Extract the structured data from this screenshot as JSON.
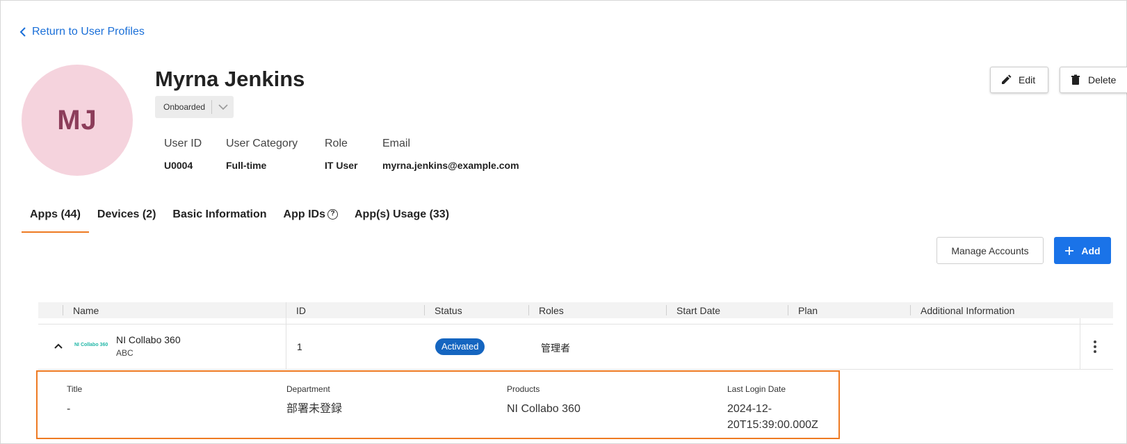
{
  "nav": {
    "back_label": "Return to User Profiles"
  },
  "user": {
    "initials": "MJ",
    "name": "Myrna Jenkins",
    "status": "Onboarded",
    "fields": [
      {
        "label": "User ID",
        "value": "U0004"
      },
      {
        "label": "User Category",
        "value": "Full-time"
      },
      {
        "label": "Role",
        "value": "IT User"
      },
      {
        "label": "Email",
        "value": "myrna.jenkins@example.com"
      }
    ]
  },
  "actions": {
    "edit_label": "Edit",
    "delete_label": "Delete"
  },
  "tabs": [
    {
      "label": "Apps (44)"
    },
    {
      "label": "Devices (2)"
    },
    {
      "label": "Basic Information"
    },
    {
      "label": "App IDs"
    },
    {
      "label": "App(s) Usage (33)"
    }
  ],
  "toolbar": {
    "manage_label": "Manage Accounts",
    "add_label": "Add"
  },
  "table": {
    "columns": [
      "Name",
      "ID",
      "Status",
      "Roles",
      "Start Date",
      "Plan",
      "Additional Information"
    ],
    "rows": [
      {
        "logo_text": "NI Collabo 360",
        "name": "NI Collabo 360",
        "sub": "ABC",
        "id": "1",
        "status": "Activated",
        "roles": "管理者",
        "start_date": "",
        "plan": "",
        "additional": ""
      }
    ]
  },
  "detail": {
    "items": [
      {
        "label": "Title",
        "value": "-"
      },
      {
        "label": "Department",
        "value": "部署未登録"
      },
      {
        "label": "Products",
        "value": "NI Collabo 360"
      },
      {
        "label": "Last Login Date",
        "value": "2024-12-20T15:39:00.000Z"
      }
    ]
  },
  "colors": {
    "accent": "#ee7a22",
    "primary": "#1a73e8",
    "badge": "#1565c0",
    "avatar_bg": "#f5d3dd"
  }
}
